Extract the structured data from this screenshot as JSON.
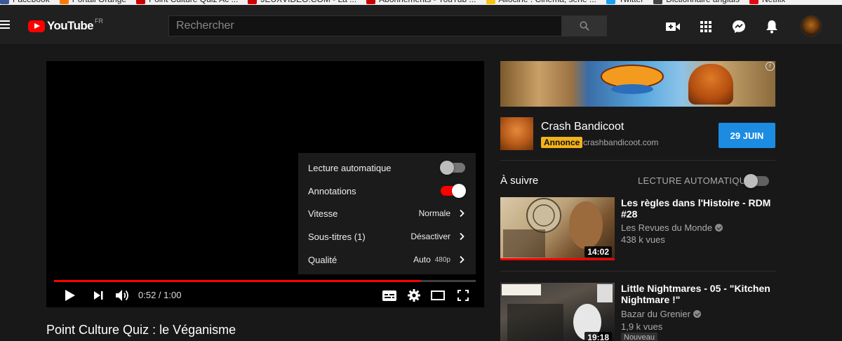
{
  "bookmarks": [
    {
      "label": "Facebook",
      "color": "#3b5998"
    },
    {
      "label": "Portail Orange",
      "color": "#ff7900"
    },
    {
      "label": "Point Culture Quiz Ac ...",
      "color": "#cc0000"
    },
    {
      "label": "JEUXVIDEO.COM - La ...",
      "color": "#cc0000"
    },
    {
      "label": "Abonnements - YouTub ...",
      "color": "#cc0000"
    },
    {
      "label": "Allociné : Cinéma, série ...",
      "color": "#f5c518"
    },
    {
      "label": "Twitter",
      "color": "#1da1f2"
    },
    {
      "label": "Dictionnaire anglais",
      "color": "#444444"
    },
    {
      "label": "Netflix",
      "color": "#e50914"
    }
  ],
  "masthead": {
    "logo_text": "YouTube",
    "logo_region": "FR",
    "search_placeholder": "Rechercher",
    "icons": [
      "upload-video-icon",
      "apps-grid-icon",
      "messages-icon",
      "notifications-bell-icon"
    ]
  },
  "player": {
    "settings_menu": {
      "autoplay_label": "Lecture automatique",
      "autoplay_on": false,
      "annotations_label": "Annotations",
      "annotations_on": true,
      "speed_label": "Vitesse",
      "speed_value": "Normale",
      "subtitles_label": "Sous-titres",
      "subtitles_count": "(1)",
      "subtitles_value": "Désactiver",
      "quality_label": "Qualité",
      "quality_value": "Auto",
      "quality_resolution": "480p"
    },
    "progress_played_fraction": 0.87,
    "time_display": "0:52 / 1:00",
    "accent_color": "#ff0000"
  },
  "video": {
    "title": "Point Culture Quiz : le Véganisme"
  },
  "ad": {
    "advertiser": "Crash Bandicoot",
    "badge": "Annonce",
    "domain": "crashbandicoot.com",
    "cta_label": "29 JUIN",
    "cta_color": "#1c8ce3",
    "badge_color": "#f2b21b",
    "info_glyph": "i"
  },
  "up_next": {
    "label": "À suivre",
    "autoplay_label": "LECTURE AUTOMATIQUE",
    "autoplay_on": false
  },
  "recommendations": [
    {
      "title": "Les règles dans l'Histoire - RDM #28",
      "channel": "Les Revues du Monde",
      "verified": true,
      "views": "438 k vues",
      "duration": "14:02",
      "watched": true,
      "badge": ""
    },
    {
      "title": "Little Nightmares - 05 - \"Kitchen Nightmare !\"",
      "channel": "Bazar du Grenier",
      "verified": true,
      "views": "1,9 k vues",
      "duration": "19:18",
      "watched": false,
      "badge": "Nouveau"
    }
  ]
}
